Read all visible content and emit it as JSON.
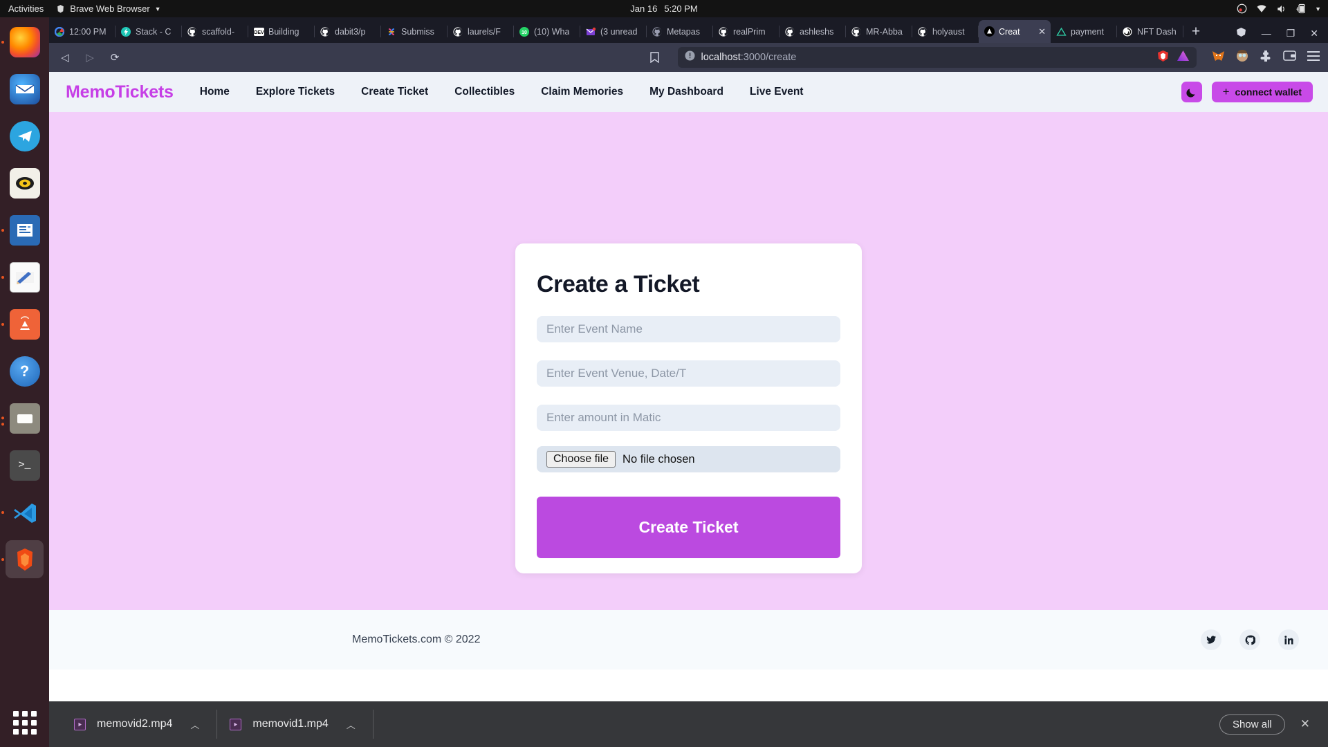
{
  "system": {
    "activities": "Activities",
    "app_menu": "Brave Web Browser",
    "clock_date": "Jan 16",
    "clock_time": "5:20 PM",
    "tray": [
      "obs-icon",
      "wifi-icon",
      "volume-icon",
      "battery-charging-icon",
      "chevron-down-icon"
    ]
  },
  "dock": {
    "items": [
      {
        "name": "firefox",
        "label": "Firefox",
        "running": true
      },
      {
        "name": "thunderbird",
        "label": "Thunderbird",
        "running": false
      },
      {
        "name": "telegram",
        "label": "Telegram",
        "running": false
      },
      {
        "name": "rhythmbox",
        "label": "Rhythmbox",
        "running": false
      },
      {
        "name": "libreoffice-writer",
        "label": "LibreOffice Writer",
        "running": true
      },
      {
        "name": "text-editor",
        "label": "Text Editor",
        "running": true
      },
      {
        "name": "ubuntu-software",
        "label": "Ubuntu Software",
        "running": true
      },
      {
        "name": "help",
        "label": "Help",
        "running": false
      },
      {
        "name": "files",
        "label": "Files",
        "running": true
      },
      {
        "name": "terminal",
        "label": "Terminal",
        "running": false
      },
      {
        "name": "vscode",
        "label": "Visual Studio Code",
        "running": true
      },
      {
        "name": "brave",
        "label": "Brave Web Browser",
        "running": true
      }
    ],
    "show_apps": "Show Applications"
  },
  "browser": {
    "tabs": [
      {
        "title": "12:00 PM",
        "favicon": "google",
        "active": false
      },
      {
        "title": "Stack - C",
        "favicon": "stackblitz",
        "active": false
      },
      {
        "title": "scaffold-",
        "favicon": "github",
        "active": false
      },
      {
        "title": "Building",
        "favicon": "dev",
        "active": false
      },
      {
        "title": "dabit3/p",
        "favicon": "github",
        "active": false
      },
      {
        "title": "Submiss",
        "favicon": "devfolio",
        "active": false
      },
      {
        "title": "laurels/F",
        "favicon": "github",
        "active": false
      },
      {
        "title": "(10) Wha",
        "favicon": "whatsapp",
        "active": false
      },
      {
        "title": "(3 unread",
        "favicon": "mail",
        "active": false
      },
      {
        "title": "Metapas",
        "favicon": "github",
        "active": false
      },
      {
        "title": "realPrim",
        "favicon": "github",
        "active": false
      },
      {
        "title": "ashleshs",
        "favicon": "github",
        "active": false
      },
      {
        "title": "MR-Abba",
        "favicon": "github",
        "active": false
      },
      {
        "title": "holyaust",
        "favicon": "github",
        "active": false
      },
      {
        "title": "Creat",
        "favicon": "vercel-solid",
        "active": true
      },
      {
        "title": "payment",
        "favicon": "triangle-outline",
        "active": false
      },
      {
        "title": "NFT Dash",
        "favicon": "spiral",
        "active": false
      }
    ],
    "new_tab_label": "+",
    "window_controls": {
      "minimize": "—",
      "maximize": "❐",
      "close": "✕"
    },
    "nav": {
      "back": "◁",
      "forward": "▷",
      "reload": "⟳",
      "bookmark": "bookmark-icon"
    },
    "url_host": "localhost",
    "url_path": ":3000/create",
    "url_right_icons": [
      "brave-shield-icon",
      "triangle-icon"
    ],
    "toolbar_right_icons": [
      "metamask-icon",
      "extension-face-icon",
      "puzzle-icon",
      "wallet-icon",
      "menu-icon"
    ]
  },
  "page": {
    "brand": "MemoTickets",
    "nav_links": [
      "Home",
      "Explore Tickets",
      "Create Ticket",
      "Collectibles",
      "Claim Memories",
      "My Dashboard",
      "Live Event"
    ],
    "theme_toggle": "moon-icon",
    "connect_wallet": "connect wallet",
    "card": {
      "title": "Create a Ticket",
      "fields": [
        {
          "placeholder": "Enter Event Name"
        },
        {
          "placeholder": "Enter Event Venue, Date/T"
        },
        {
          "placeholder": "Enter amount in Matic"
        }
      ],
      "file_button": "Choose file",
      "file_status": "No file chosen",
      "submit": "Create Ticket"
    },
    "footer": {
      "copyright": "MemoTickets.com © 2022",
      "socials": [
        "twitter-icon",
        "github-icon",
        "linkedin-icon"
      ]
    }
  },
  "downloads": {
    "items": [
      {
        "filename": "memovid2.mp4"
      },
      {
        "filename": "memovid1.mp4"
      }
    ],
    "show_all": "Show all",
    "close": "✕"
  },
  "colors": {
    "page_bg": "#f3cefa",
    "accent": "#c84ae8",
    "button": "#bb4ae0",
    "navbar_bg": "#eef2f8",
    "field_bg": "#e8eef6"
  }
}
